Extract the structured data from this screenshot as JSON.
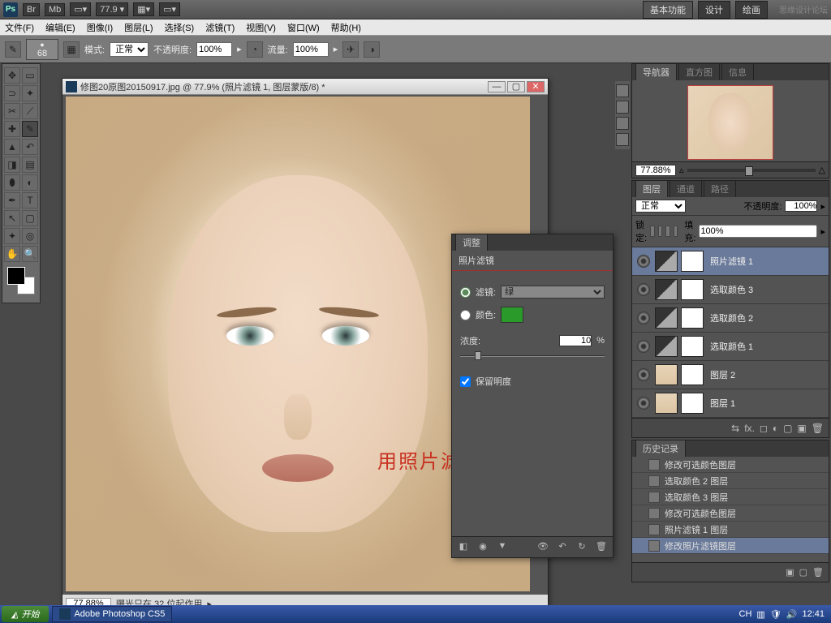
{
  "titlebar": {
    "zoom": "77.9",
    "btn_basic": "基本功能",
    "btn_design": "设计",
    "btn_paint": "绘画",
    "watermark": "思缘设计论坛"
  },
  "menu": [
    "文件(F)",
    "编辑(E)",
    "图像(I)",
    "图层(L)",
    "选择(S)",
    "滤镜(T)",
    "视图(V)",
    "窗口(W)",
    "帮助(H)"
  ],
  "optbar": {
    "brush_size": "68",
    "mode_lbl": "模式:",
    "mode": "正常",
    "opacity_lbl": "不透明度:",
    "opacity": "100%",
    "flow_lbl": "流量:",
    "flow": "100%"
  },
  "doc": {
    "title": "修图20原图20150917.jpg @ 77.9% (照片滤镜 1, 图层蒙版/8) *",
    "status_zoom": "77.88%",
    "status_msg": "曝光只在 32 位起作用",
    "overlay": "用照片滤镜调色"
  },
  "adjust": {
    "tab": "调整",
    "title": "照片滤镜",
    "filter_lbl": "滤镜:",
    "filter_val": "绿",
    "color_lbl": "颜色:",
    "density_lbl": "浓度:",
    "density_val": "10",
    "pct": "%",
    "preserve": "保留明度"
  },
  "nav": {
    "t1": "导航器",
    "t2": "直方图",
    "t3": "信息",
    "zoom": "77.88%"
  },
  "layers": {
    "t1": "图层",
    "t2": "通道",
    "t3": "路径",
    "blend": "正常",
    "op_lbl": "不透明度:",
    "op": "100%",
    "lock_lbl": "锁定:",
    "fill_lbl": "填充:",
    "fill": "100%",
    "items": [
      {
        "n": "照片滤镜 1",
        "t": "adj",
        "sel": true
      },
      {
        "n": "选取颜色 3",
        "t": "adj"
      },
      {
        "n": "选取颜色 2",
        "t": "adj"
      },
      {
        "n": "选取颜色 1",
        "t": "adj"
      },
      {
        "n": "图层 2",
        "t": "img"
      },
      {
        "n": "图层 1",
        "t": "img",
        "mask": true
      }
    ]
  },
  "history": {
    "tab": "历史记录",
    "items": [
      "修改可选颜色图层",
      "选取颜色 2 图层",
      "选取颜色 3 图层",
      "修改可选颜色图层",
      "照片滤镜 1 图层",
      "修改照片滤镜图层"
    ]
  },
  "taskbar": {
    "start": "开始",
    "app": "Adobe Photoshop CS5",
    "lang": "CH",
    "time": "12:41"
  }
}
